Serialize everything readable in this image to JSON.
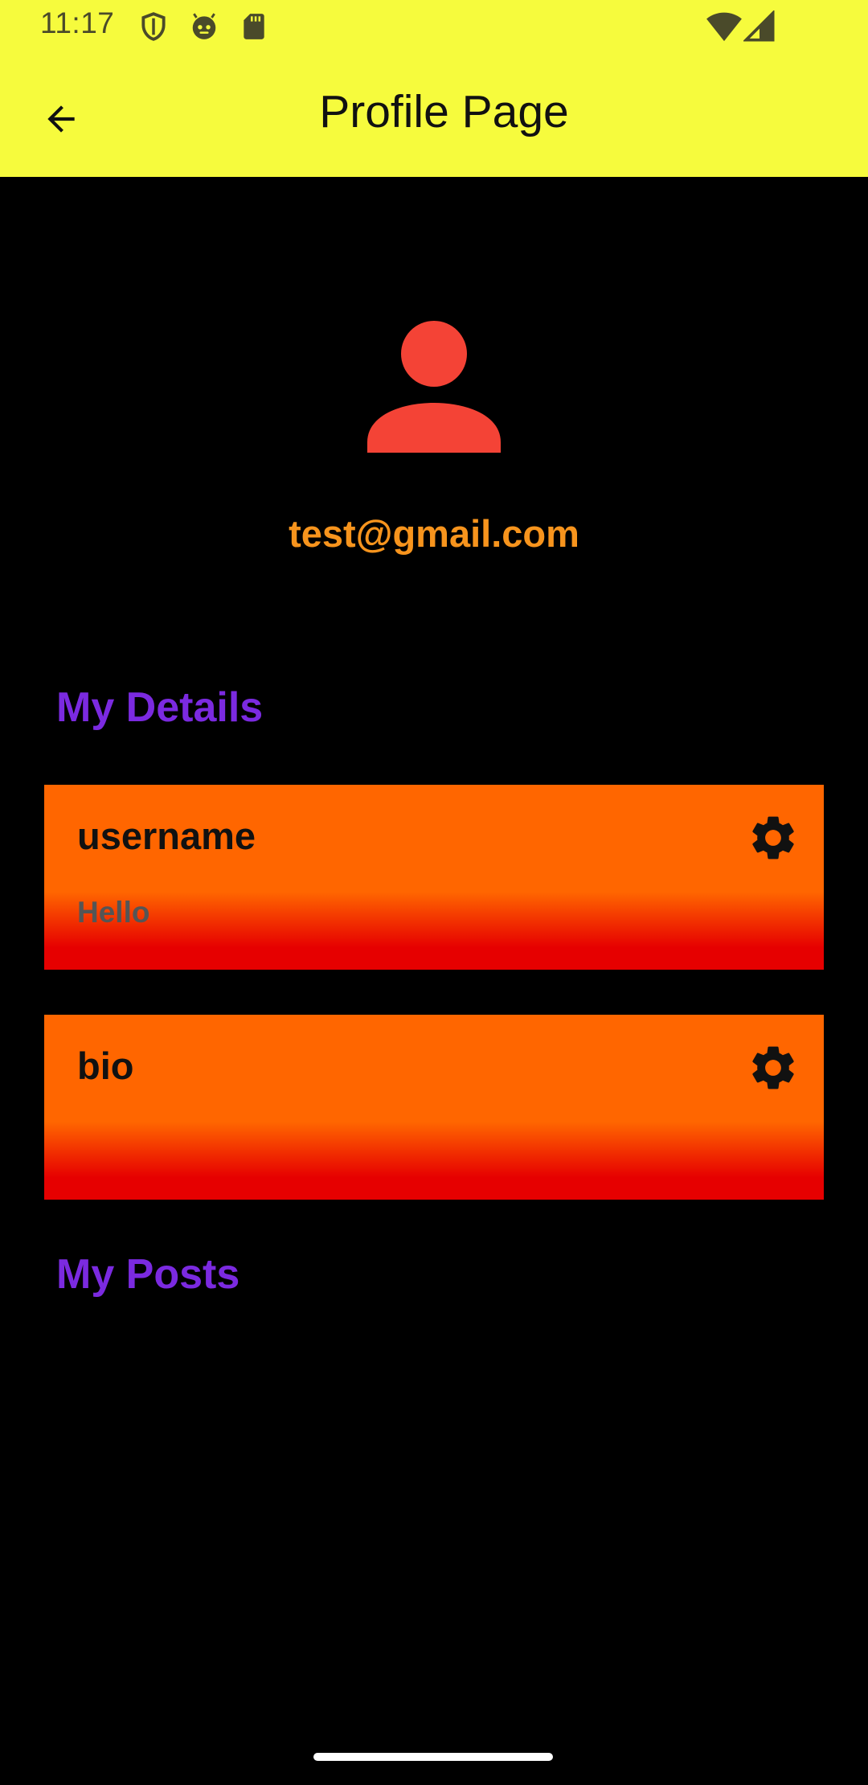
{
  "status_bar": {
    "time": "11:17",
    "left_icons": [
      "shield-icon",
      "face-icon",
      "sd-card-icon"
    ],
    "right_icons": [
      "wifi-icon",
      "cell-signal-icon"
    ]
  },
  "app_bar": {
    "title": "Profile Page",
    "back_icon": "arrow-back-icon",
    "background_color": "#f6fb3d"
  },
  "profile": {
    "avatar_icon": "person-icon",
    "avatar_color": "#f44336",
    "email": "test@gmail.com",
    "email_color": "#f7941d"
  },
  "details": {
    "title": "My Details",
    "title_color": "#7b2ae0",
    "fields": [
      {
        "label": "username",
        "value": "Hello",
        "icon": "gear-icon"
      },
      {
        "label": "bio",
        "value": "",
        "icon": "gear-icon"
      }
    ]
  },
  "posts": {
    "title": "My Posts"
  },
  "card_colors": {
    "top": "#ff6600",
    "bottom": "#e60000"
  }
}
